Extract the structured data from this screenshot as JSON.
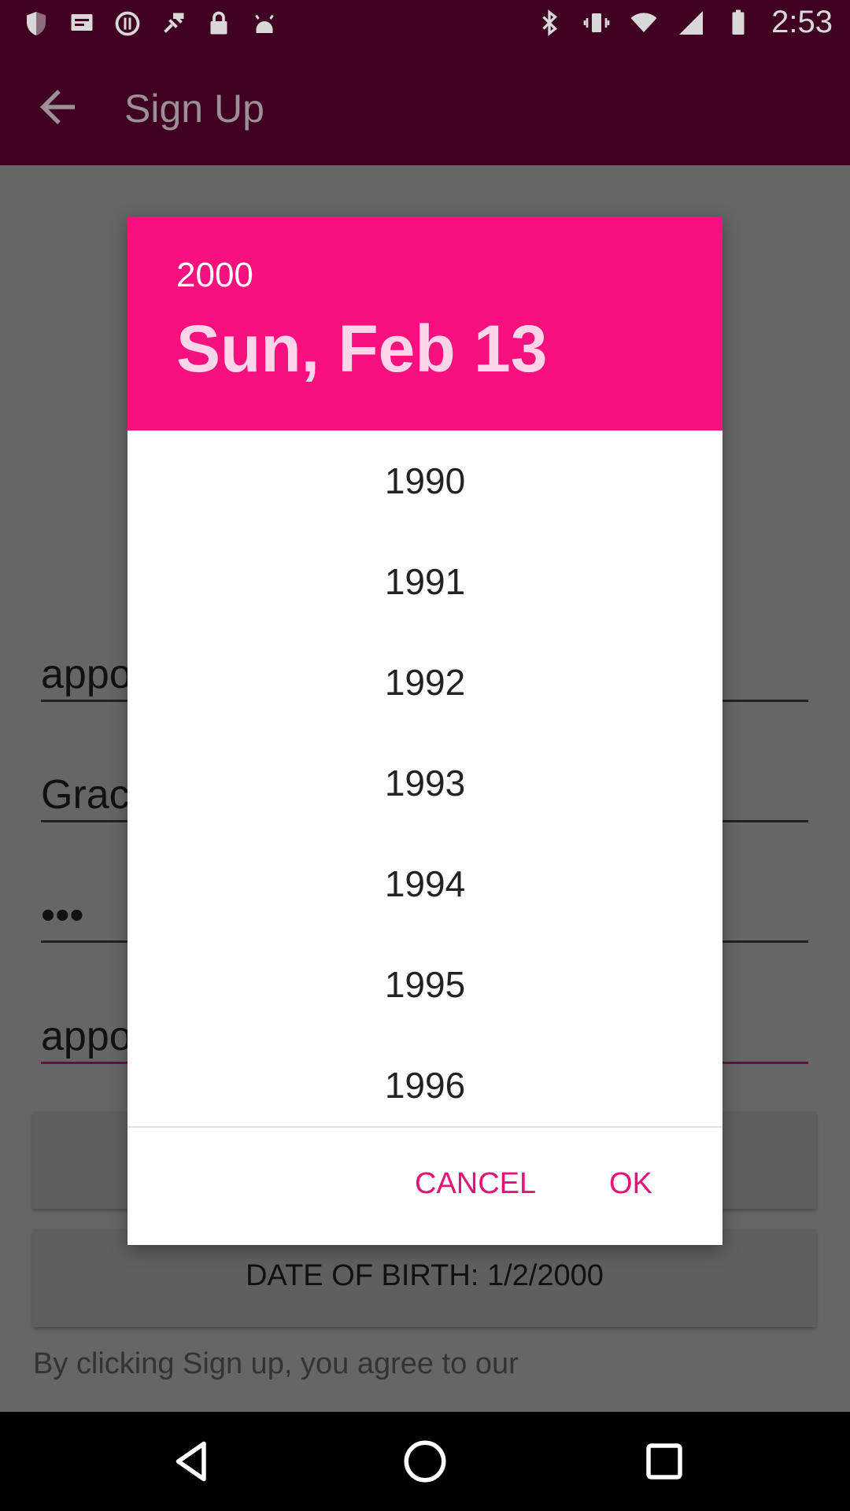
{
  "status_bar": {
    "time": "2:53",
    "icons_left": [
      "shield-icon",
      "message-icon",
      "sync-alert-icon",
      "fake-gps-icon",
      "lock-icon",
      "android-icon"
    ],
    "icons_right": [
      "bluetooth-icon",
      "vibrate-icon",
      "wifi-icon",
      "signal-icon",
      "battery-icon"
    ]
  },
  "app_bar": {
    "title": "Sign Up",
    "back_icon": "arrow-back-icon"
  },
  "form": {
    "field1_value": "appo",
    "field2_value": "Grac",
    "field3_value": "•••",
    "field4_value": "appo",
    "dob_label": "DATE OF BIRTH: 1/2/2000",
    "terms_text": "By clicking Sign up, you agree to our"
  },
  "dialog": {
    "header_year": "2000",
    "header_date": "Sun, Feb 13",
    "years": [
      "1990",
      "1991",
      "1992",
      "1993",
      "1994",
      "1995",
      "1996"
    ],
    "cancel_label": "CANCEL",
    "ok_label": "OK"
  },
  "nav_bar": {
    "icons": [
      "back-triangle-icon",
      "home-circle-icon",
      "recents-square-icon"
    ]
  },
  "colors": {
    "accent": "#f8107f",
    "button_text": "#e8117a",
    "app_bar": "#3f0022"
  }
}
